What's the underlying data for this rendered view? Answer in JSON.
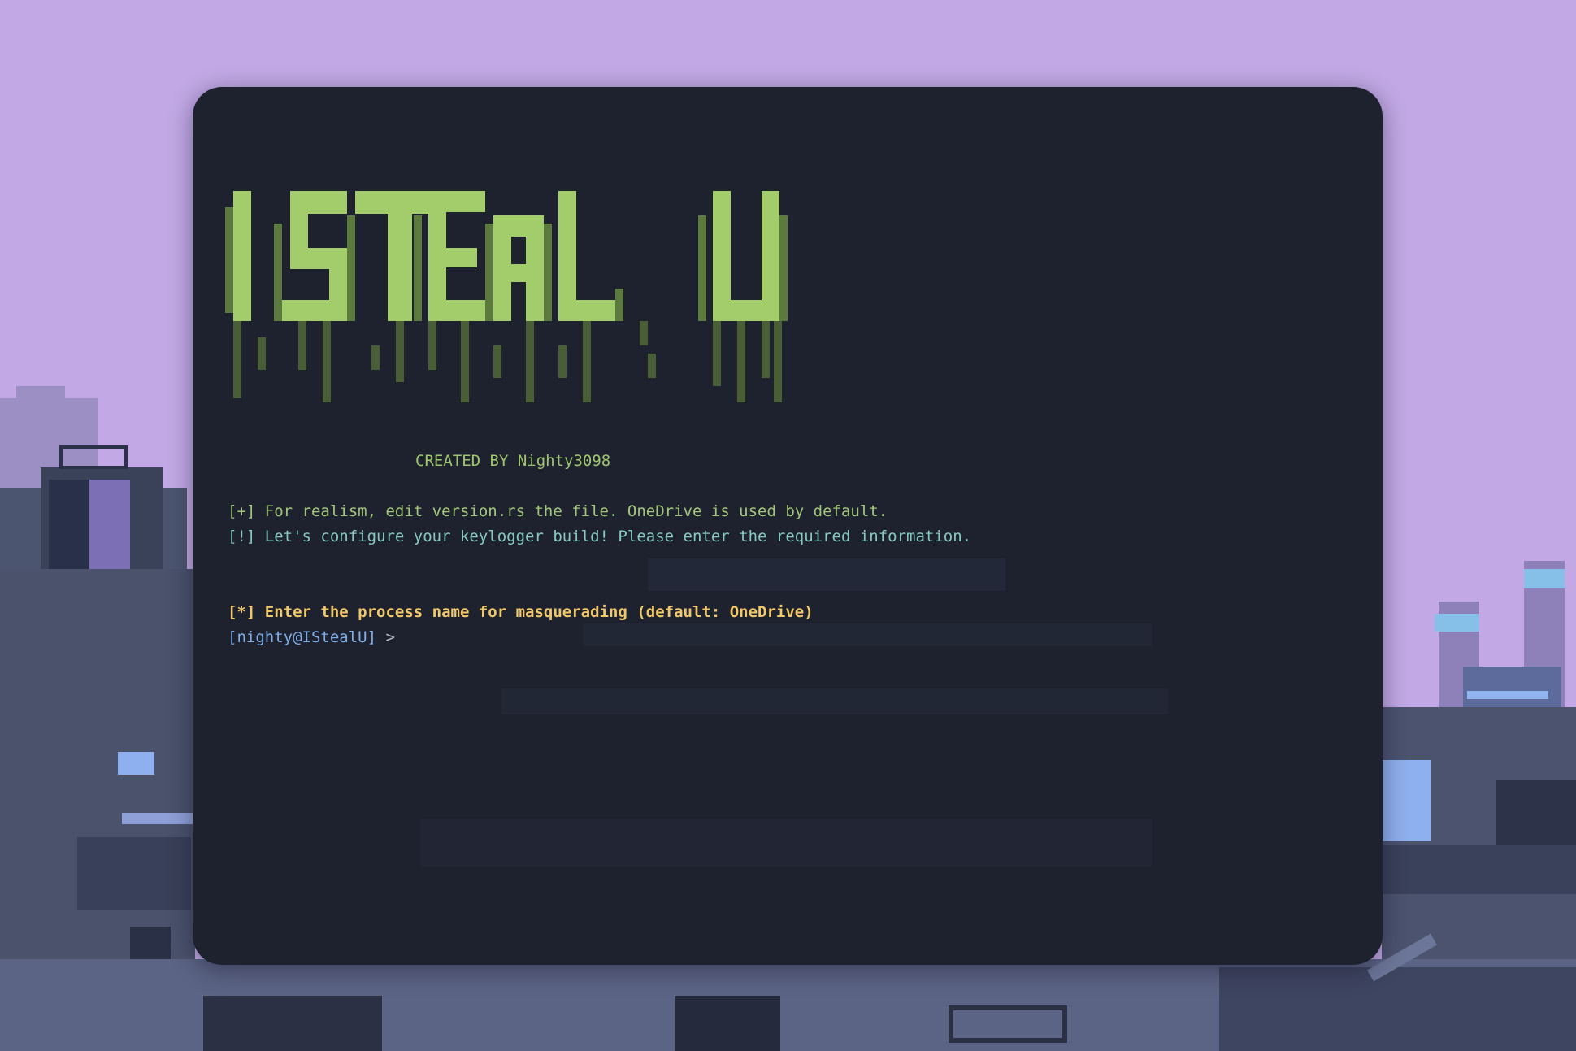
{
  "colors": {
    "sky": "#c2a9e6",
    "terminal_bg": "#1e222e",
    "banner_green": "#a3cc6a",
    "info_green": "#a3c77a",
    "warn_teal": "#86c9c0",
    "prompt_yellow": "#f0c869",
    "user_blue": "#7faee8"
  },
  "banner": {
    "art_text": "I STEAL U",
    "credit": "CREATED BY Nighty3098"
  },
  "messages": {
    "info": "[+] For realism, edit version.rs the file. OneDrive is used by default.",
    "warn": "[!] Let's configure your keylogger build! Please enter the required information."
  },
  "prompt": {
    "question": "[*] Enter the process name for masquerading (default: OneDrive)",
    "user_host": "[nighty@IStealU]",
    "arrow": " >",
    "input_value": ""
  }
}
